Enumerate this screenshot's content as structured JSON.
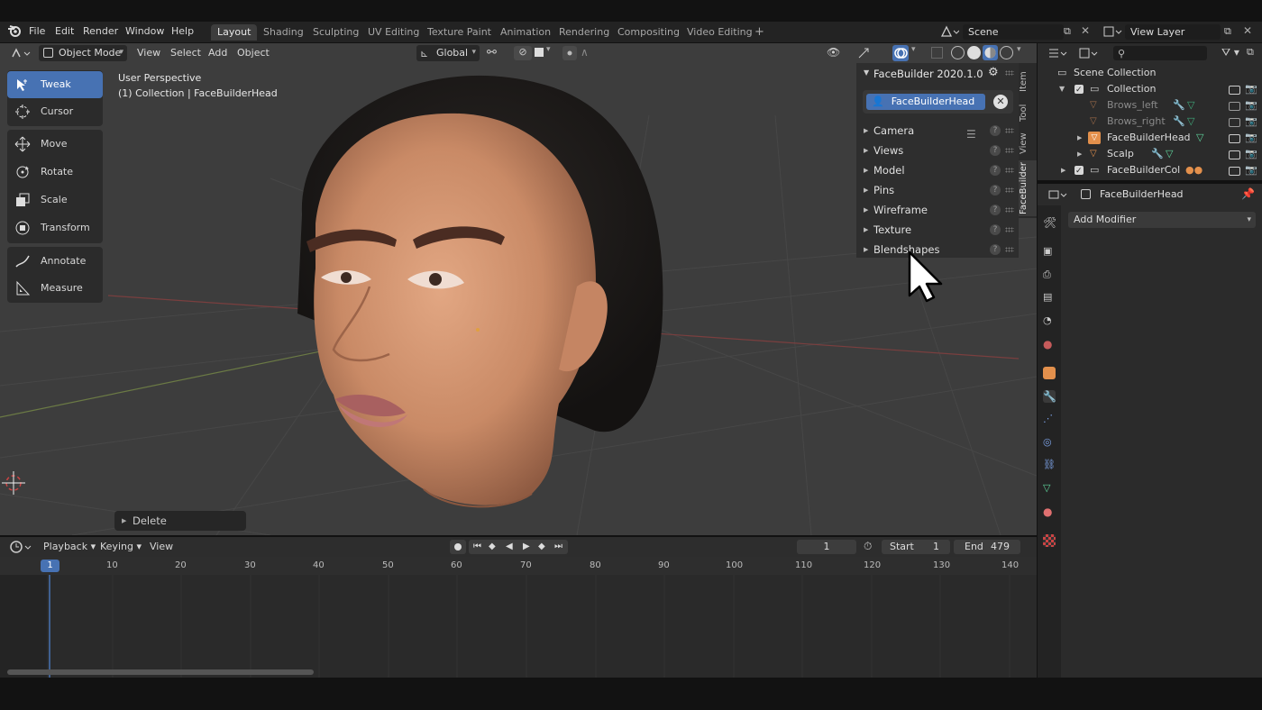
{
  "menus": [
    "File",
    "Edit",
    "Render",
    "Window",
    "Help"
  ],
  "workspaces": [
    "Layout",
    "Shading",
    "Sculpting",
    "UV Editing",
    "Texture Paint",
    "Animation",
    "Rendering",
    "Compositing",
    "Video Editing",
    "+"
  ],
  "scene_name": "Scene",
  "view_layer": "View Layer",
  "viewport": {
    "mode": "Object Mode",
    "menus": [
      "View",
      "Select",
      "Add",
      "Object"
    ],
    "transform_orientation": "Global",
    "overlay_line1": "User Perspective",
    "overlay_line2": "(1) Collection | FaceBuilderHead",
    "last_operator": "Delete"
  },
  "tools": [
    "Tweak",
    "Cursor",
    "Move",
    "Rotate",
    "Scale",
    "Transform",
    "Annotate",
    "Measure"
  ],
  "facebuilder": {
    "title": "FaceBuilder 2020.1.0",
    "head_button": "FaceBuilderHead",
    "sections": [
      "Camera",
      "Views",
      "Model",
      "Pins",
      "Wireframe",
      "Texture",
      "Blendshapes"
    ]
  },
  "side_tabs": [
    "Item",
    "Tool",
    "View",
    "FaceBuilder"
  ],
  "timeline": {
    "menus": [
      "Playback",
      "Keying",
      "View"
    ],
    "current_frame": "1",
    "start_label": "Start",
    "start": "1",
    "end_label": "End",
    "end": "479",
    "ruler": [
      "1",
      "10",
      "20",
      "30",
      "40",
      "50",
      "60",
      "70",
      "80",
      "90",
      "100",
      "110",
      "120",
      "130",
      "140"
    ]
  },
  "outliner": {
    "root": "Scene Collection",
    "items": [
      {
        "label": "Collection"
      },
      {
        "label": "Brows_left"
      },
      {
        "label": "Brows_right"
      },
      {
        "label": "FaceBuilderHead"
      },
      {
        "label": "Scalp"
      },
      {
        "label": "FaceBuilderCol"
      }
    ]
  },
  "properties": {
    "object_name": "FaceBuilderHead",
    "add_modifier": "Add Modifier"
  },
  "colors": {
    "accent": "#4772b3",
    "orange": "#e3904c",
    "green": "#5fd39b"
  }
}
